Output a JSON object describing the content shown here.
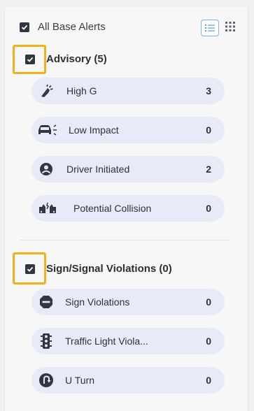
{
  "all_alerts": {
    "label": "All Base Alerts",
    "checked": true
  },
  "view_toggle": {
    "list_icon": "list-view-icon",
    "grid_icon": "grid-view-icon"
  },
  "sections": [
    {
      "title": "Advisory (5)",
      "checked": true,
      "items": [
        {
          "label": "High G",
          "count": "3",
          "icon": "high-g-icon"
        },
        {
          "label": "Low Impact",
          "count": "0",
          "icon": "low-impact-icon"
        },
        {
          "label": "Driver Initiated",
          "count": "2",
          "icon": "driver-initiated-icon"
        },
        {
          "label": "Potential Collision",
          "count": "0",
          "icon": "potential-collision-icon"
        }
      ]
    },
    {
      "title": "Sign/Signal Violations (0)",
      "checked": true,
      "items": [
        {
          "label": "Sign Violations",
          "count": "0",
          "icon": "stop-sign-icon"
        },
        {
          "label": "Traffic Light Viola...",
          "count": "0",
          "icon": "traffic-light-icon"
        },
        {
          "label": "U Turn",
          "count": "0",
          "icon": "u-turn-icon"
        }
      ]
    }
  ],
  "colors": {
    "pill_bg": "#e6ebf7",
    "highlight": "#f2b11b",
    "checkbox": "#2f3742",
    "active_view_border": "#7fb3e8"
  }
}
